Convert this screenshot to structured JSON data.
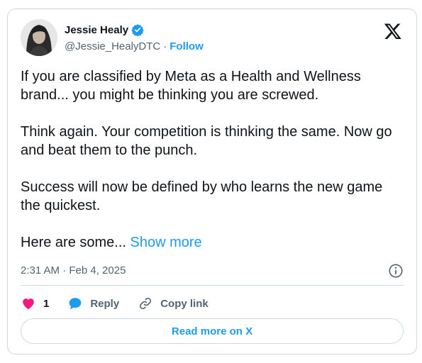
{
  "author": {
    "display_name": "Jessie Healy",
    "handle": "@Jessie_HealyDTC",
    "separator": "·",
    "follow_label": "Follow",
    "verified": true
  },
  "platform_icon": "x-logo-icon",
  "tweet": {
    "paragraphs": [
      "If you are classified by Meta as a Health and Wellness brand... you might be thinking you are screwed.",
      "Think again. Your competition is thinking the same. Now go and beat them to the punch.",
      "Success will now be defined by who learns the new game the quickest."
    ],
    "truncated_text": "Here are some...",
    "show_more_label": "Show more"
  },
  "timestamp": "2:31 AM · Feb 4, 2025",
  "actions": {
    "like_count": "1",
    "reply_label": "Reply",
    "copy_link_label": "Copy link"
  },
  "read_more_label": "Read more on X",
  "colors": {
    "accent": "#1d9bf0",
    "like": "#f91880",
    "text": "#0f1419",
    "muted": "#536471",
    "border": "#cfd9de"
  }
}
